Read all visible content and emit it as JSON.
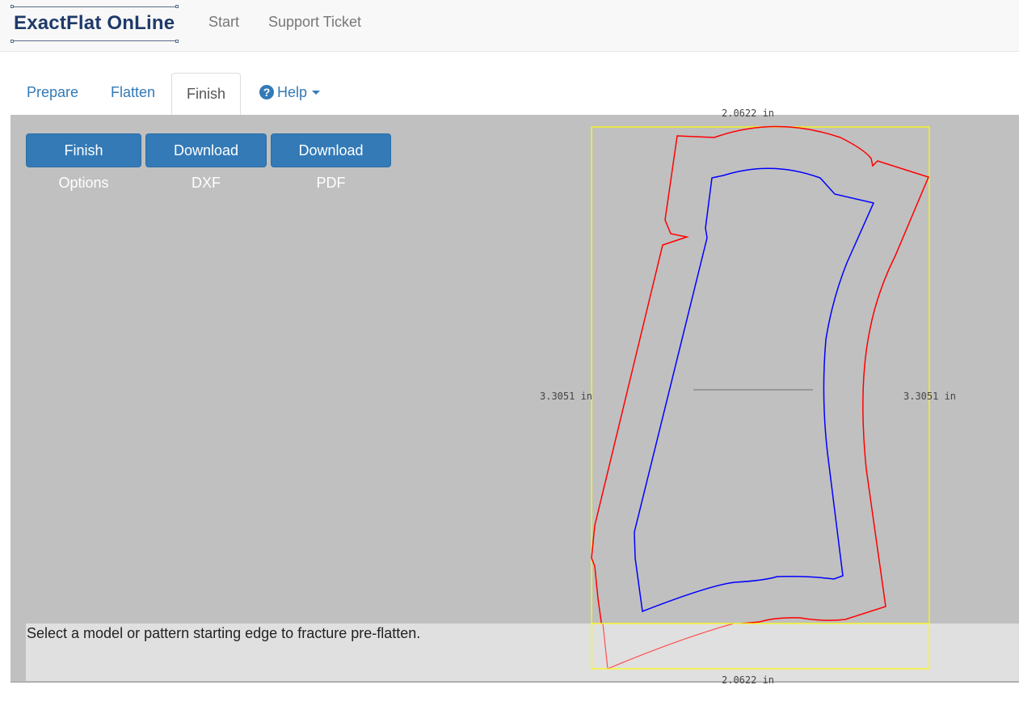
{
  "navbar": {
    "brand": "ExactFlat OnLine",
    "links": [
      "Start",
      "Support Ticket"
    ]
  },
  "tabs": {
    "prepare": "Prepare",
    "flatten": "Flatten",
    "finish": "Finish",
    "help": "Help"
  },
  "toolbar": {
    "finish_options": "Finish Options",
    "download_dxf": "Download DXF",
    "download_pdf": "Download PDF"
  },
  "canvas": {
    "dim_top": "2.0622 in",
    "dim_bottom": "2.0622 in",
    "dim_left": "3.3051 in",
    "dim_right": "3.3051 in",
    "colors": {
      "bounding_box": "#ffff00",
      "outer_pattern": "#ff0000",
      "inner_pattern": "#0000ff"
    }
  },
  "status": {
    "message": "Select a model or pattern starting edge to fracture pre-flatten."
  }
}
